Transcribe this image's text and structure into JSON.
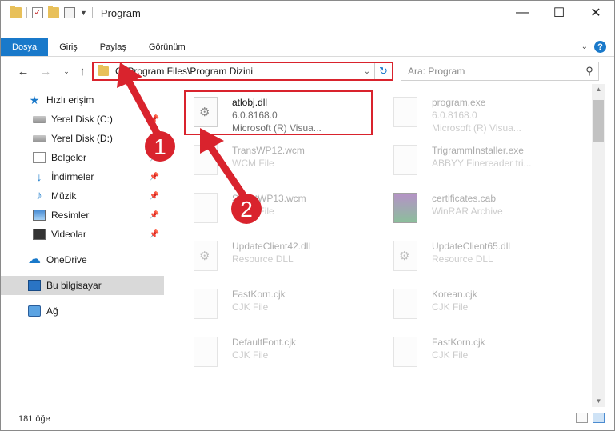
{
  "window": {
    "title": "Program",
    "controls": {
      "minimize": "—",
      "maximize": "☐",
      "close": "✕"
    }
  },
  "ribbon": {
    "tabs": [
      {
        "label": "Dosya",
        "active": true
      },
      {
        "label": "Giriş"
      },
      {
        "label": "Paylaş"
      },
      {
        "label": "Görünüm"
      }
    ],
    "expand_icon": "chevron-down-icon",
    "help_label": "?"
  },
  "nav": {
    "address": "C:\\Program Files\\Program Dizini",
    "search_placeholder": "Ara: Program"
  },
  "sidebar": {
    "items": [
      {
        "label": "Hızlı erişim",
        "icon": "star-icon"
      },
      {
        "label": "Yerel Disk (C:)",
        "icon": "drive-icon"
      },
      {
        "label": "Yerel Disk (D:)",
        "icon": "drive-icon"
      },
      {
        "label": "Belgeler",
        "icon": "documents-icon"
      },
      {
        "label": "İndirmeler",
        "icon": "downloads-icon"
      },
      {
        "label": "Müzik",
        "icon": "music-icon"
      },
      {
        "label": "Resimler",
        "icon": "pictures-icon"
      },
      {
        "label": "Videolar",
        "icon": "videos-icon"
      },
      {
        "label": "OneDrive",
        "icon": "cloud-icon"
      },
      {
        "label": "Bu bilgisayar",
        "icon": "pc-icon"
      },
      {
        "label": "Ağ",
        "icon": "network-icon"
      }
    ]
  },
  "files": [
    {
      "name": "atlobj.dll",
      "line1": "6.0.8168.0",
      "line2": "Microsoft (R) Visua..."
    },
    {
      "name": "program.exe",
      "line1": "6.0.8168.0",
      "line2": "Microsoft (R) Visua..."
    },
    {
      "name": "TransWP12.wcm",
      "line1": "WCM File",
      "line2": ""
    },
    {
      "name": "TrigrammInstaller.exe",
      "line1": "ABBYY Finereader tri...",
      "line2": ""
    },
    {
      "name": "SmartWP13.wcm",
      "line1": "WCM File",
      "line2": ""
    },
    {
      "name": "certificates.cab",
      "line1": "WinRAR Archive",
      "line2": ""
    },
    {
      "name": "UpdateClient42.dll",
      "line1": "Resource DLL",
      "line2": ""
    },
    {
      "name": "UpdateClient65.dll",
      "line1": "Resource DLL",
      "line2": ""
    },
    {
      "name": "FastKorn.cjk",
      "line1": "CJK File",
      "line2": ""
    },
    {
      "name": "Korean.cjk",
      "line1": "CJK File",
      "line2": ""
    },
    {
      "name": "DefaultFont.cjk",
      "line1": "CJK File",
      "line2": ""
    },
    {
      "name": "FastKorn.cjk",
      "line1": "CJK File",
      "line2": ""
    }
  ],
  "status": {
    "count": "181 öğe"
  },
  "annotations": {
    "step1": "1",
    "step2": "2",
    "color": "#d9232d"
  }
}
